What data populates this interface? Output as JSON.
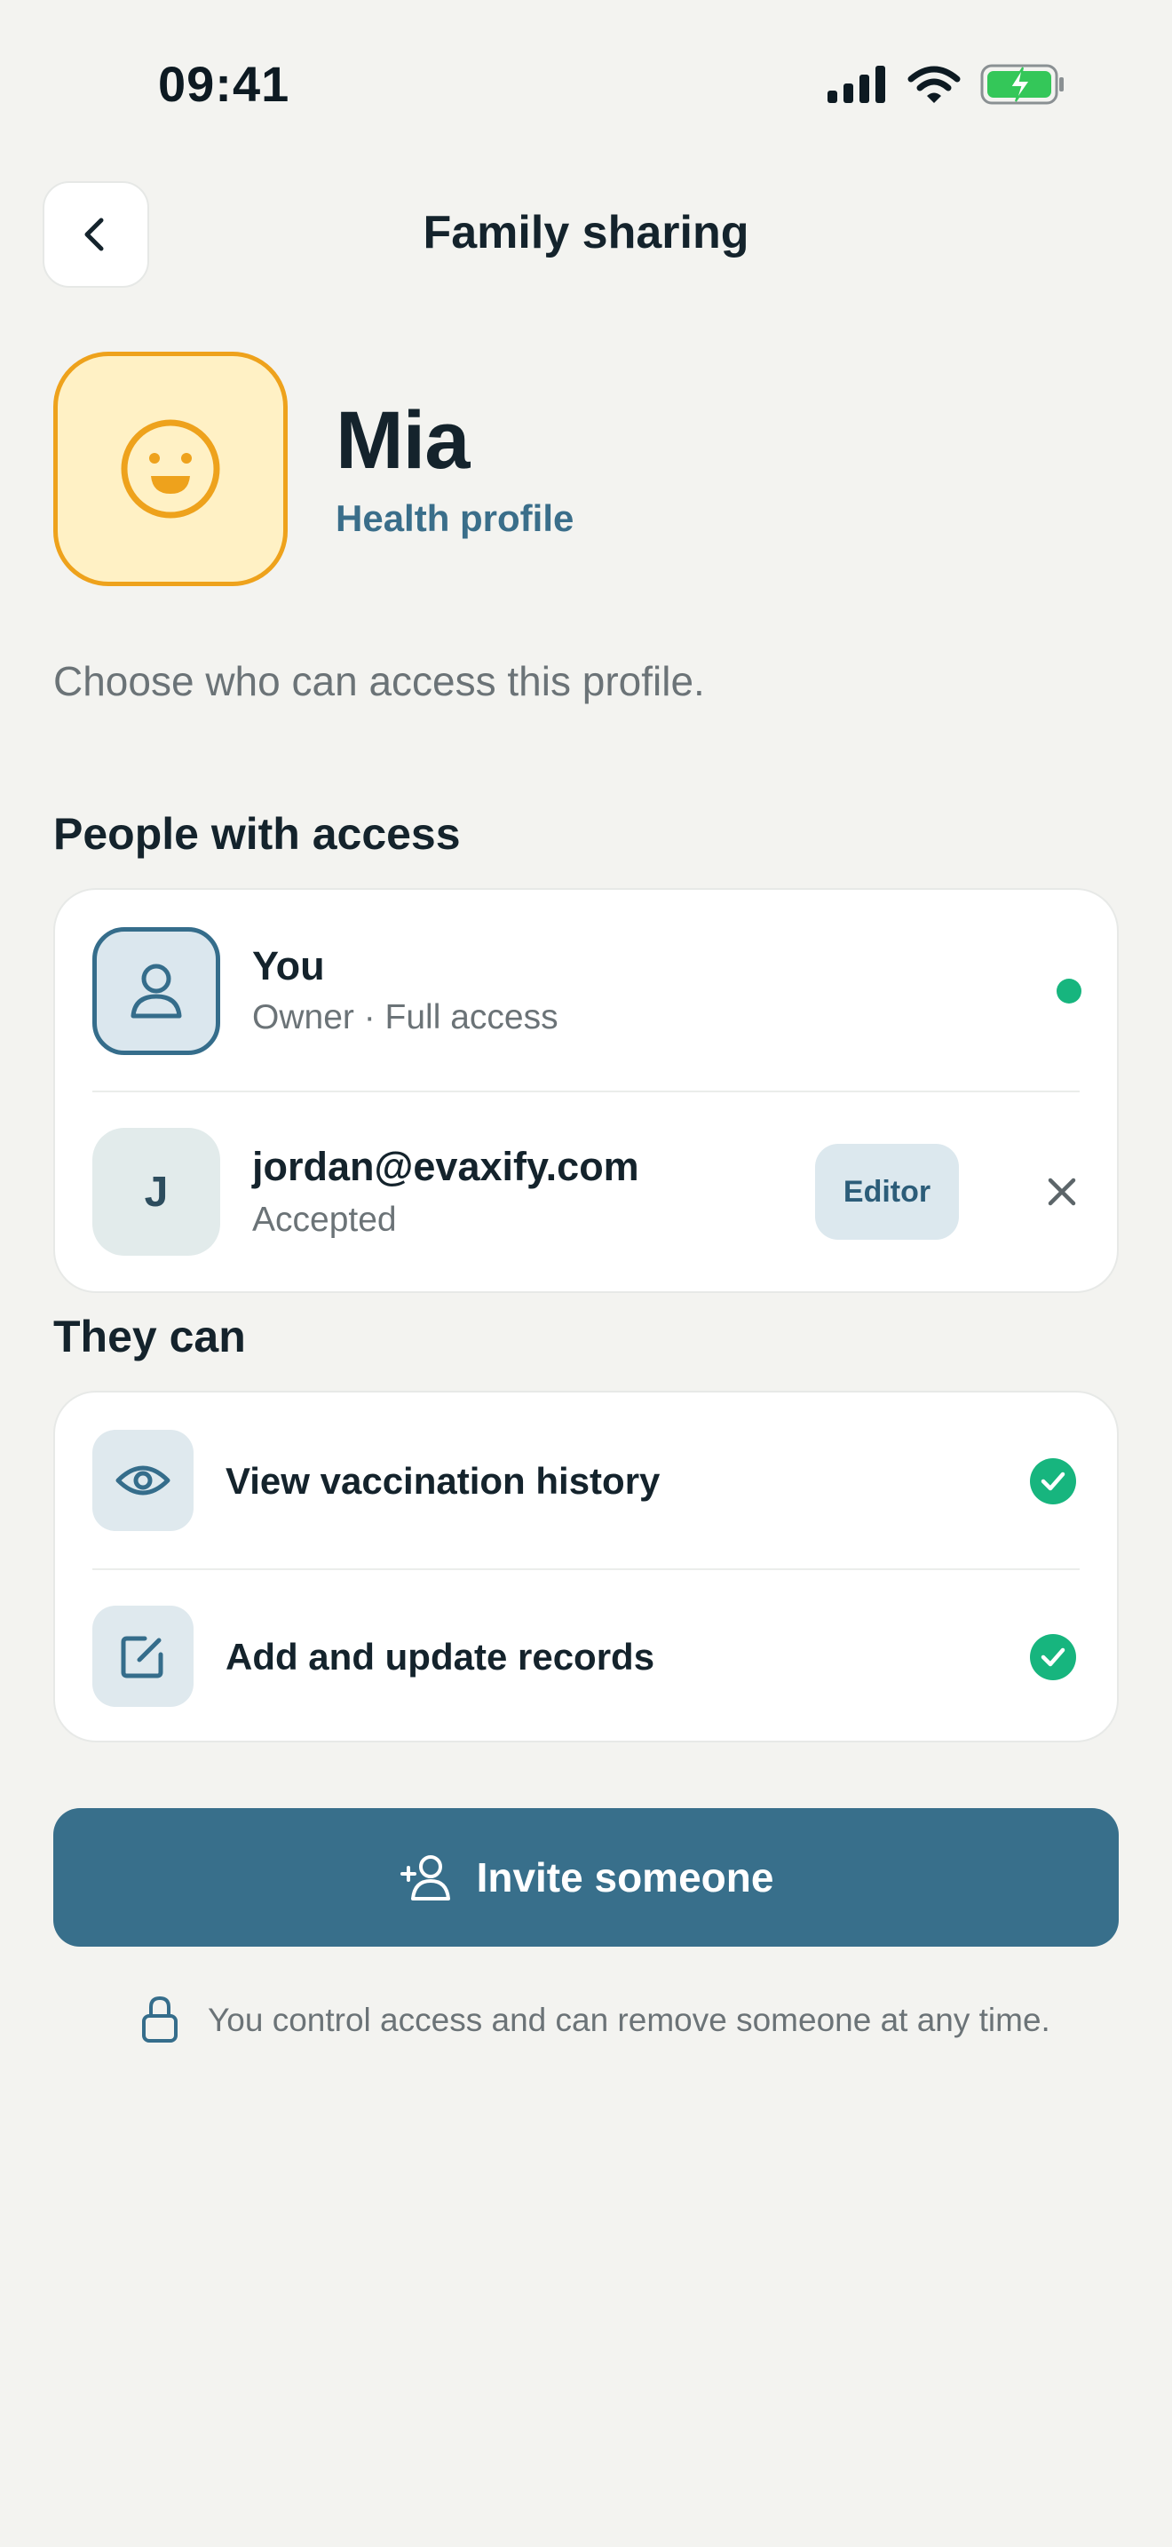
{
  "status_bar": {
    "time": "09:41",
    "icons": [
      "signal-icon",
      "wifi-icon",
      "battery-charging-icon"
    ]
  },
  "header": {
    "title": "Family sharing",
    "back_icon": "chevron-left-icon"
  },
  "profile": {
    "name": "Mia",
    "subtitle": "Health profile",
    "avatar_icon": "smile-face-icon",
    "avatar_color": "#eea21c"
  },
  "intro": "Choose who can access this profile.",
  "access": {
    "title": "People with access",
    "people": [
      {
        "name": "You",
        "detail": "Owner · Full access",
        "status": "online"
      },
      {
        "initial": "J",
        "name": "jordan@evaxify.com",
        "detail": "Accepted",
        "role": "Editor"
      }
    ]
  },
  "permissions": {
    "title": "They can",
    "items": [
      {
        "label": "View vaccination history",
        "icon": "eye-icon",
        "enabled": true
      },
      {
        "label": "Add and update records",
        "icon": "edit-icon",
        "enabled": true
      }
    ]
  },
  "invite": {
    "label": "Invite someone",
    "icon": "add-user-icon"
  },
  "footnote": "You control access and can remove someone at any time.",
  "colors": {
    "primary": "#386f8b",
    "success": "#17b57e",
    "background": "#f3f3f0"
  }
}
